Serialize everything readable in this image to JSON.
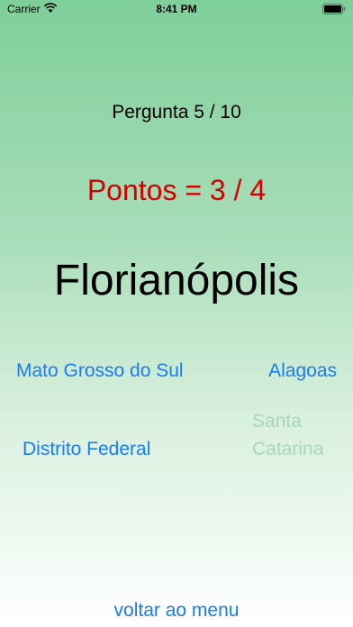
{
  "status_bar": {
    "carrier": "Carrier",
    "time": "8:41 PM",
    "wifi_icon": "wifi-icon",
    "battery_icon": "battery-icon"
  },
  "quiz": {
    "question_counter": "Pergunta 5 / 10",
    "score": "Pontos = 3 / 4",
    "city": "Florianópolis",
    "answers": [
      {
        "label": "Mato Grosso do Sul",
        "enabled": true
      },
      {
        "label": "Alagoas",
        "enabled": true
      },
      {
        "label": "Distrito Federal",
        "enabled": true
      },
      {
        "label": "Santa Catarina",
        "enabled": false
      }
    ],
    "back_label": "voltar ao menu"
  },
  "colors": {
    "accent": "#1a7cf0",
    "score": "#d40000",
    "disabled": "#a8d8b6",
    "gradient_top": "#7fcf9a",
    "gradient_bottom": "#ffffff"
  }
}
